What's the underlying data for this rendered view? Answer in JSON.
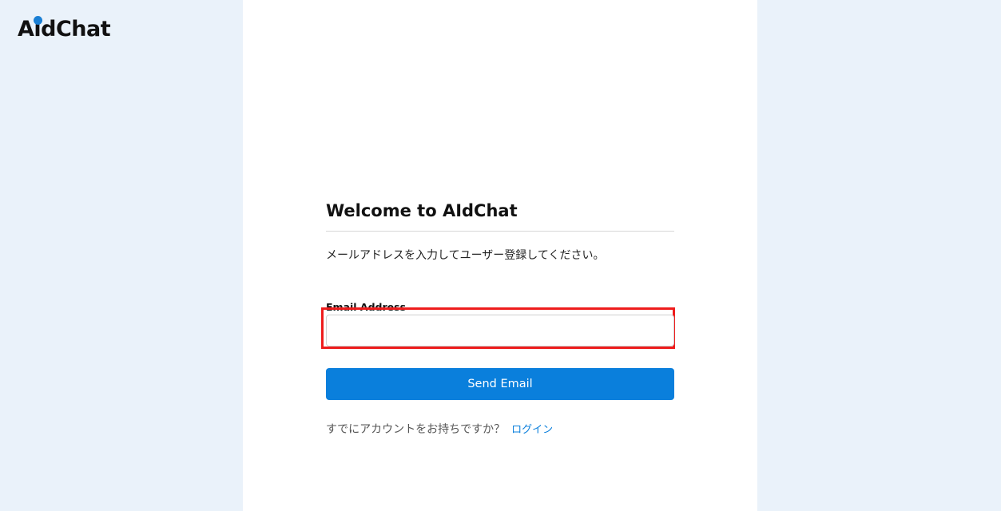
{
  "brand": {
    "name": "AidChat",
    "accent_color": "#1a7fd4"
  },
  "form": {
    "title": "Welcome to AIdChat",
    "description": "メールアドレスを入力してユーザー登録してください。",
    "email_label": "Email Address",
    "email_value": "",
    "send_label": "Send Email",
    "login_prompt": "すでにアカウントをお持ちですか？",
    "login_link": "ログイン",
    "button_color": "#0a7fdc",
    "highlight_color": "#ee1c1c"
  }
}
